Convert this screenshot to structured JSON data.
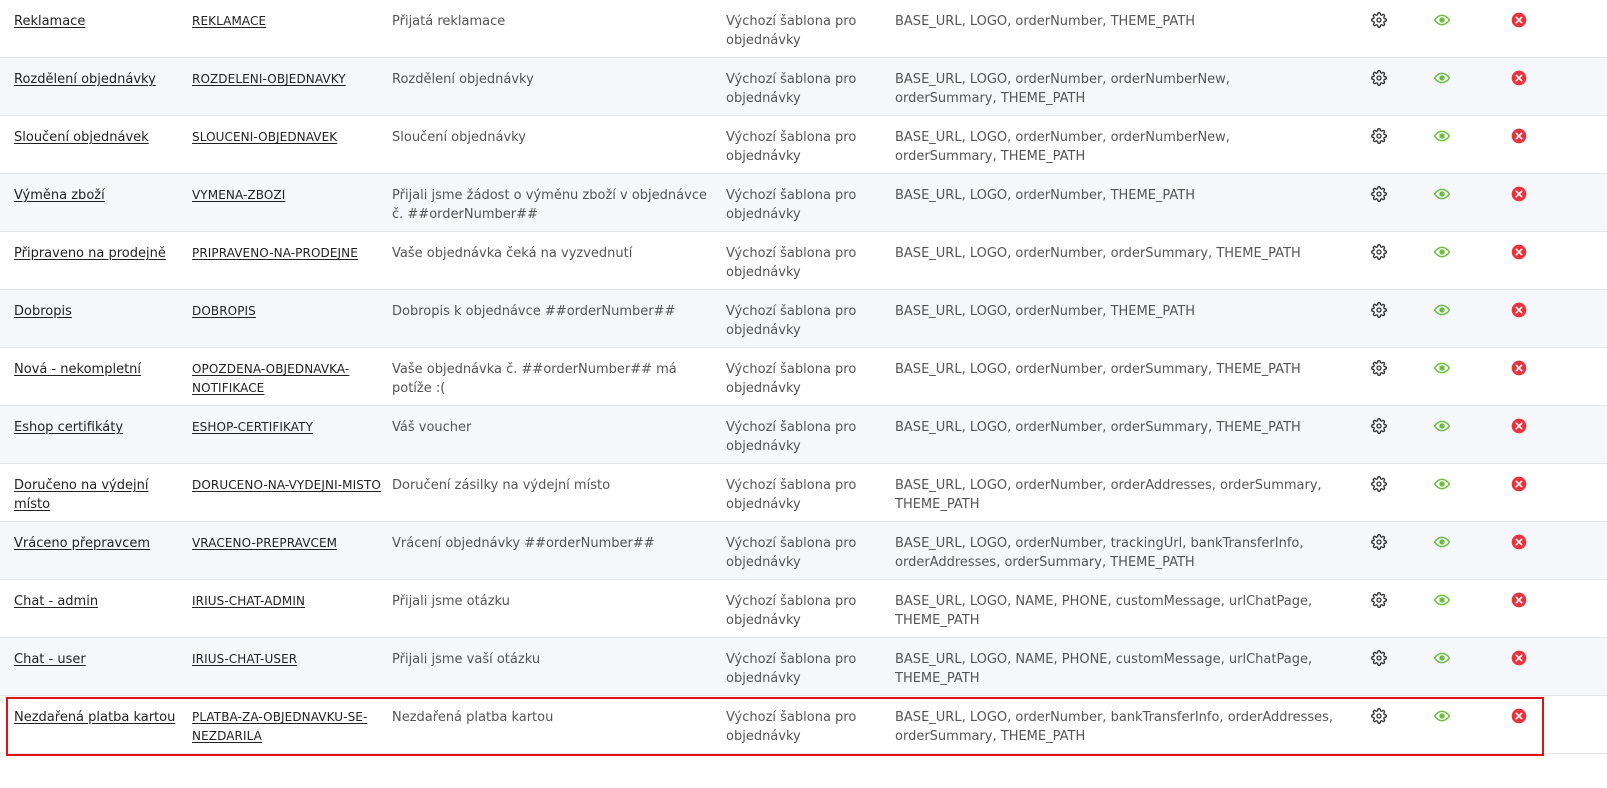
{
  "colors": {
    "gear": "#333333",
    "eye": "#6cbf3c",
    "delete": "#e8323c",
    "highlight": "#e3101a"
  },
  "icons": {
    "settings": "gear-icon",
    "preview": "eye-icon",
    "delete": "close-circle-icon"
  },
  "rows": [
    {
      "name": "Reklamace",
      "code": "REKLAMACE",
      "subject": "Přijatá reklamace",
      "template": "Výchozí šablona pro objednávky",
      "variables": "BASE_URL, LOGO, orderNumber, THEME_PATH"
    },
    {
      "name": "Rozdělení objednávky",
      "code": "ROZDELENI-OBJEDNAVKY",
      "subject": "Rozdělení objednávky",
      "template": "Výchozí šablona pro objednávky",
      "variables": "BASE_URL, LOGO, orderNumber, orderNumberNew, orderSummary, THEME_PATH"
    },
    {
      "name": "Sloučení objednávek",
      "code": "SLOUCENI-OBJEDNAVEK",
      "subject": "Sloučení objednávky",
      "template": "Výchozí šablona pro objednávky",
      "variables": "BASE_URL, LOGO, orderNumber, orderNumberNew, orderSummary, THEME_PATH"
    },
    {
      "name": "Výměna zboží",
      "code": "VYMENA-ZBOZI",
      "subject": "Přijali jsme žádost o výměnu zboží v objednávce č. ##orderNumber##",
      "template": "Výchozí šablona pro objednávky",
      "variables": "BASE_URL, LOGO, orderNumber, THEME_PATH"
    },
    {
      "name": "Připraveno na prodejně",
      "code": "PRIPRAVENO-NA-PRODEJNE",
      "subject": "Vaše objednávka čeká na vyzvednutí",
      "template": "Výchozí šablona pro objednávky",
      "variables": "BASE_URL, LOGO, orderNumber, orderSummary, THEME_PATH"
    },
    {
      "name": "Dobropis",
      "code": "DOBROPIS",
      "subject": "Dobropis k objednávce ##orderNumber##",
      "template": "Výchozí šablona pro objednávky",
      "variables": "BASE_URL, LOGO, orderNumber, THEME_PATH"
    },
    {
      "name": "Nová - nekompletní",
      "code": "OPOZDENA-OBJEDNAVKA-NOTIFIKACE",
      "subject": "Vaše objednávka č. ##orderNumber## má potíže :(",
      "template": "Výchozí šablona pro objednávky",
      "variables": "BASE_URL, LOGO, orderNumber, orderSummary, THEME_PATH"
    },
    {
      "name": "Eshop certifikáty",
      "code": "ESHOP-CERTIFIKATY",
      "subject": "Váš voucher",
      "template": "Výchozí šablona pro objednávky",
      "variables": "BASE_URL, LOGO, orderNumber, orderSummary, THEME_PATH"
    },
    {
      "name": "Doručeno na výdejní místo",
      "code": "DORUCENO-NA-VYDEJNI-MISTO",
      "subject": "Doručení zásilky na výdejní místo",
      "template": "Výchozí šablona pro objednávky",
      "variables": "BASE_URL, LOGO, orderNumber, orderAddresses, orderSummary, THEME_PATH"
    },
    {
      "name": "Vráceno přepravcem",
      "code": "VRACENO-PREPRAVCEM",
      "subject": "Vrácení objednávky ##orderNumber##",
      "template": "Výchozí šablona pro objednávky",
      "variables": "BASE_URL, LOGO, orderNumber, trackingUrl, bankTransferInfo, orderAddresses, orderSummary, THEME_PATH"
    },
    {
      "name": "Chat - admin",
      "code": "IRIUS-CHAT-ADMIN",
      "subject": "Přijali jsme otázku",
      "template": "Výchozí šablona pro objednávky",
      "variables": "BASE_URL, LOGO, NAME, PHONE, customMessage, urlChatPage, THEME_PATH"
    },
    {
      "name": "Chat - user",
      "code": "IRIUS-CHAT-USER",
      "subject": "Přijali jsme vaší otázku",
      "template": "Výchozí šablona pro objednávky",
      "variables": "BASE_URL, LOGO, NAME, PHONE, customMessage, urlChatPage, THEME_PATH"
    },
    {
      "name": "Nezdařená platba kartou",
      "code": "PLATBA-ZA-OBJEDNAVKU-SE-NEZDARILA",
      "subject": "Nezdařená platba kartou",
      "template": "Výchozí šablona pro objednávky",
      "variables": "BASE_URL, LOGO, orderNumber, bankTransferInfo, orderAddresses, orderSummary, THEME_PATH"
    }
  ]
}
